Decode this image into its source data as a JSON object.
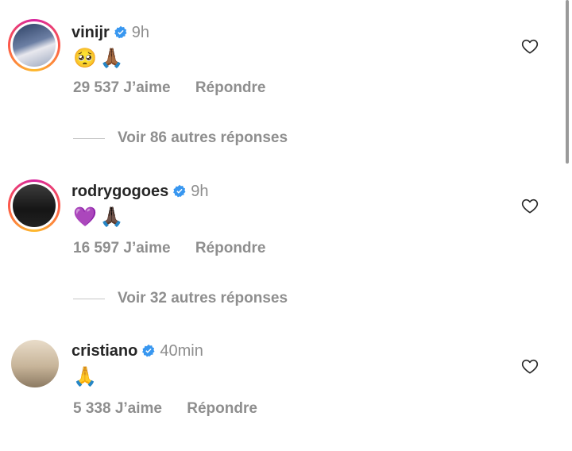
{
  "comments": [
    {
      "username": "vinijr",
      "time": "9h",
      "emojis": [
        "🥺",
        "🙏🏾"
      ],
      "likes": "29 537 J’aime",
      "reply_label": "Répondre",
      "view_replies": "Voir 86 autres réponses"
    },
    {
      "username": "rodrygogoes",
      "time": "9h",
      "emojis": [
        "💜",
        "🙏🏿"
      ],
      "likes": "16 597 J’aime",
      "reply_label": "Répondre",
      "view_replies": "Voir 32 autres réponses"
    },
    {
      "username": "cristiano",
      "time": "40min",
      "emojis": [
        "🙏"
      ],
      "likes": "5 338 J’aime",
      "reply_label": "Répondre"
    }
  ],
  "colors": {
    "verified": "#3897f0",
    "muted_text": "#8e8e8e",
    "primary_text": "#262626"
  },
  "icons": {
    "verified": "verified-badge-icon",
    "like": "heart-outline-icon"
  }
}
